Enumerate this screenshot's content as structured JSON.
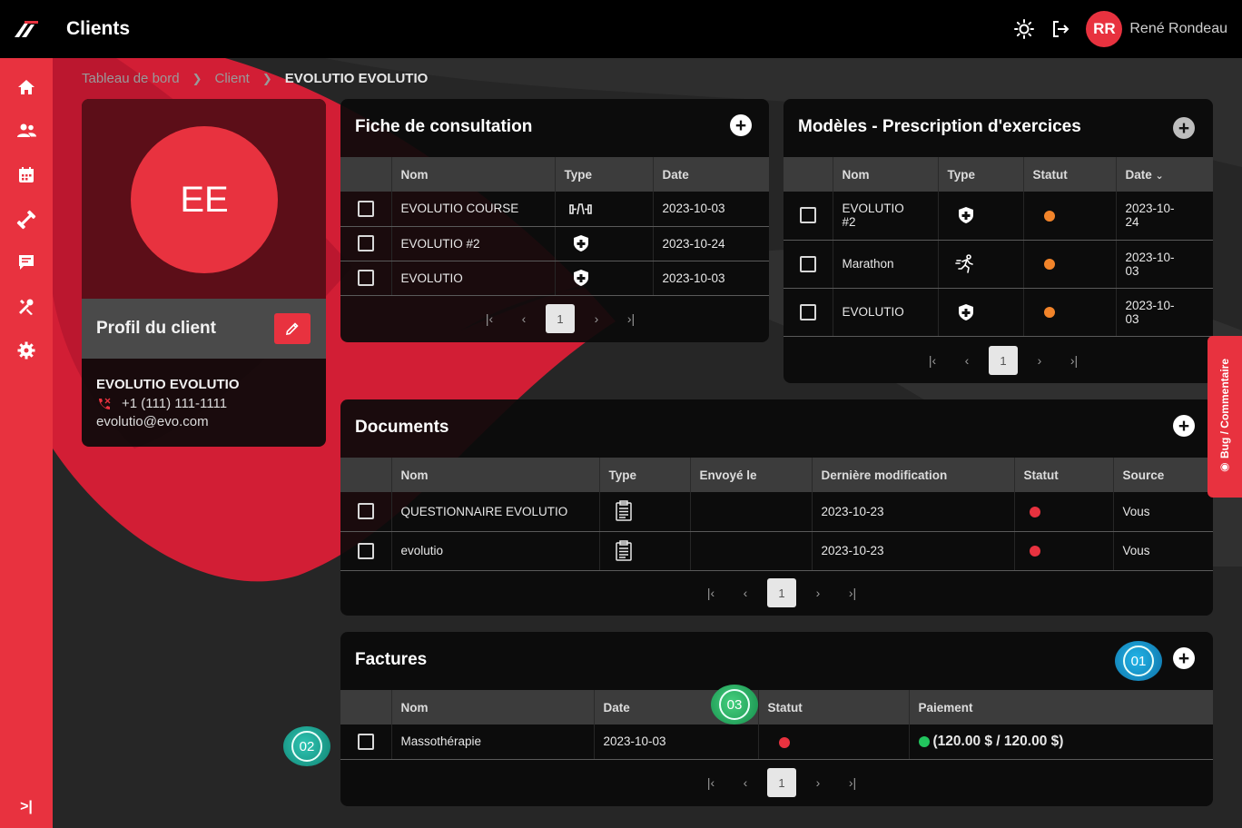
{
  "header": {
    "title": "Clients",
    "user_initials": "RR",
    "user_name": "René Rondeau"
  },
  "sidebar": {
    "items": [
      {
        "name": "home"
      },
      {
        "name": "clients"
      },
      {
        "name": "calendar"
      },
      {
        "name": "exercises"
      },
      {
        "name": "messages"
      },
      {
        "name": "tools"
      },
      {
        "name": "settings"
      }
    ],
    "collapse_label": ">|"
  },
  "breadcrumb": [
    "Tableau de bord",
    "Client",
    "EVOLUTIO EVOLUTIO"
  ],
  "profile": {
    "initials": "EE",
    "section_label": "Profil du client",
    "name": "EVOLUTIO EVOLUTIO",
    "phone": "+1 (111) 111-1111",
    "email": "evolutio@evo.com"
  },
  "consultation": {
    "title": "Fiche de consultation",
    "columns": [
      "Nom",
      "Type",
      "Date"
    ],
    "rows": [
      {
        "name": "EVOLUTIO COURSE",
        "type_icon": "fitness-icon",
        "date": "2023-10-03"
      },
      {
        "name": "EVOLUTIO #2",
        "type_icon": "shield-icon",
        "date": "2023-10-24"
      },
      {
        "name": "EVOLUTIO",
        "type_icon": "shield-icon",
        "date": "2023-10-03"
      }
    ],
    "page": "1"
  },
  "models": {
    "title": "Modèles - Prescription d'exercices",
    "columns": [
      "Nom",
      "Type",
      "Statut",
      "Date"
    ],
    "rows": [
      {
        "name_l1": "EVOLUTIO",
        "name_l2": "#2",
        "type_icon": "shield-icon",
        "date_l1": "2023-10-",
        "date_l2": "24"
      },
      {
        "name_l1": "Marathon",
        "name_l2": "",
        "type_icon": "runner-icon",
        "date_l1": "2023-10-",
        "date_l2": "03"
      },
      {
        "name_l1": "EVOLUTIO",
        "name_l2": "",
        "type_icon": "shield-icon",
        "date_l1": "2023-10-",
        "date_l2": "03"
      }
    ],
    "page": "1"
  },
  "documents": {
    "title": "Documents",
    "columns": [
      "Nom",
      "Type",
      "Envoyé le",
      "Dernière modification",
      "Statut",
      "Source"
    ],
    "rows": [
      {
        "name": "QUESTIONNAIRE EVOLUTIO",
        "sent": "",
        "modified": "2023-10-23",
        "source": "Vous"
      },
      {
        "name": "evolutio",
        "sent": "",
        "modified": "2023-10-23",
        "source": "Vous"
      }
    ],
    "page": "1"
  },
  "invoices": {
    "title": "Factures",
    "columns": [
      "Nom",
      "Date",
      "Statut",
      "Paiement"
    ],
    "rows": [
      {
        "name": "Massothérapie",
        "date": "2023-10-03",
        "payment": "(120.00 $ / 120.00 $)"
      }
    ],
    "page": "1"
  },
  "bug_tab": {
    "label": "Bug / Commentaire"
  },
  "markers": [
    "01",
    "02",
    "03"
  ],
  "colors": {
    "brand": "#e8323f",
    "status_orange": "#f2842a",
    "status_red": "#e8323f",
    "status_green": "#22c55e",
    "marker_teal": "#1aa89a",
    "marker_blue": "#1b9ed8"
  }
}
